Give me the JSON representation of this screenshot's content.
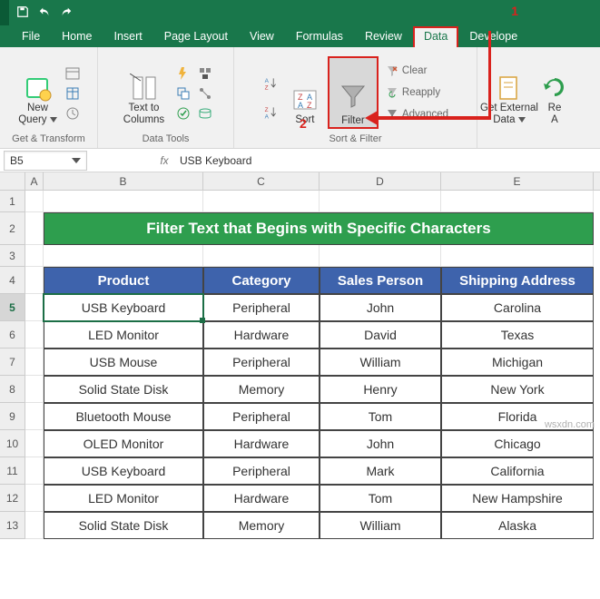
{
  "titlebar": {},
  "tabs": {
    "file": "File",
    "home": "Home",
    "insert": "Insert",
    "pagelayout": "Page Layout",
    "view": "View",
    "formulas": "Formulas",
    "review": "Review",
    "data": "Data",
    "developer": "Develope"
  },
  "annot": {
    "one": "1",
    "two": "2"
  },
  "ribbon": {
    "get_transform": {
      "new_query": "New\nQuery",
      "label": "Get & Transform"
    },
    "data_tools": {
      "text_to_columns": "Text to\nColumns",
      "label": "Data Tools"
    },
    "sort_filter": {
      "sort": "Sort",
      "filter": "Filter",
      "clear": "Clear",
      "reapply": "Reapply",
      "advanced": "Advanced",
      "label": "Sort & Filter"
    },
    "external": {
      "get_external": "Get External\nData",
      "refresh": "Re\nA"
    }
  },
  "namebox": "B5",
  "formula": "USB Keyboard",
  "columns": [
    "A",
    "B",
    "C",
    "D",
    "E"
  ],
  "rows": [
    "1",
    "2",
    "3",
    "4",
    "5",
    "6",
    "7",
    "8",
    "9",
    "10",
    "11",
    "12",
    "13"
  ],
  "sheet": {
    "title": "Filter Text that Begins with Specific Characters",
    "headers": {
      "b": "Product",
      "c": "Category",
      "d": "Sales Person",
      "e": "Shipping Address"
    }
  },
  "chart_data": {
    "type": "table",
    "columns": [
      "Product",
      "Category",
      "Sales Person",
      "Shipping Address"
    ],
    "rows": [
      [
        "USB Keyboard",
        "Peripheral",
        "John",
        "Carolina"
      ],
      [
        "LED Monitor",
        "Hardware",
        "David",
        "Texas"
      ],
      [
        "USB Mouse",
        "Peripheral",
        "William",
        "Michigan"
      ],
      [
        "Solid State Disk",
        "Memory",
        "Henry",
        "New York"
      ],
      [
        "Bluetooth Mouse",
        "Peripheral",
        "Tom",
        "Florida"
      ],
      [
        "OLED Monitor",
        "Hardware",
        "John",
        "Chicago"
      ],
      [
        "USB Keyboard",
        "Peripheral",
        "Mark",
        "California"
      ],
      [
        "LED Monitor",
        "Hardware",
        "Tom",
        "New Hampshire"
      ],
      [
        "Solid State Disk",
        "Memory",
        "William",
        "Alaska"
      ]
    ]
  },
  "watermark": "wsxdn.com"
}
